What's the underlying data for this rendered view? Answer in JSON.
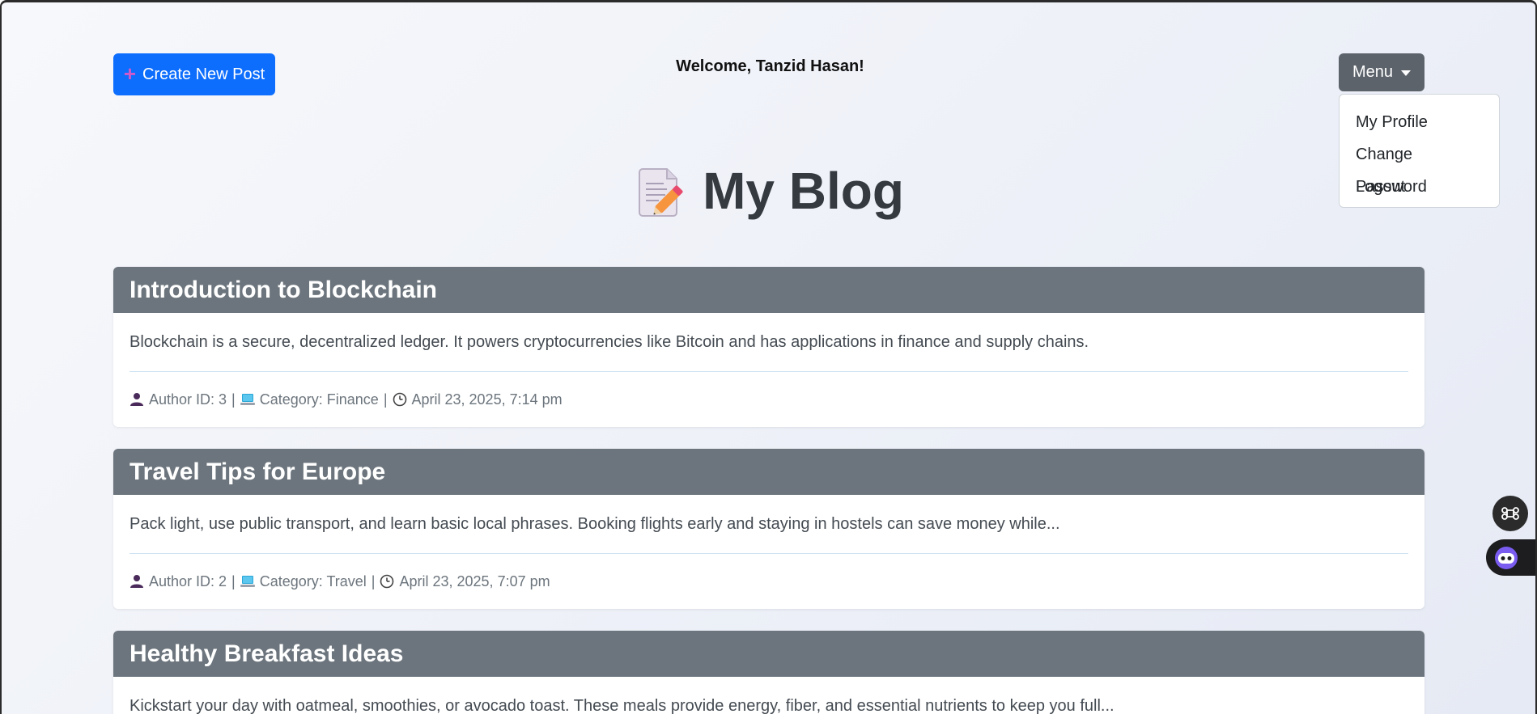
{
  "header": {
    "create_label": "Create New Post",
    "welcome_text": "Welcome, Tanzid Hasan!",
    "menu_label": "Menu"
  },
  "menu": {
    "items": [
      {
        "label": "My Profile"
      },
      {
        "label": "Change Password"
      },
      {
        "label": "Logout"
      }
    ]
  },
  "page": {
    "title": "My Blog"
  },
  "posts": [
    {
      "title": "Introduction to Blockchain",
      "excerpt": "Blockchain is a secure, decentralized ledger. It powers cryptocurrencies like Bitcoin and has applications in finance and supply chains.",
      "author": "Author ID: 3",
      "category": "Category: Finance",
      "date": "April 23, 2025, 7:14 pm"
    },
    {
      "title": "Travel Tips for Europe",
      "excerpt": "Pack light, use public transport, and learn basic local phrases. Booking flights early and staying in hostels can save money while...",
      "author": "Author ID: 2",
      "category": "Category: Travel",
      "date": "April 23, 2025, 7:07 pm"
    },
    {
      "title": "Healthy Breakfast Ideas",
      "excerpt": "Kickstart your day with oatmeal, smoothies, or avocado toast. These meals provide energy, fiber, and essential nutrients to keep you full..."
    }
  ],
  "meta_separator": "|",
  "icons": {
    "create": "plus-icon",
    "menu": "caret-down-icon",
    "title": "memo-icon",
    "author": "person-icon",
    "category": "laptop-icon",
    "date": "clock-icon"
  },
  "colors": {
    "primary": "#0d6efd",
    "secondary": "#6c757d",
    "menu_button": "#5c636a",
    "title": "#343a40"
  }
}
